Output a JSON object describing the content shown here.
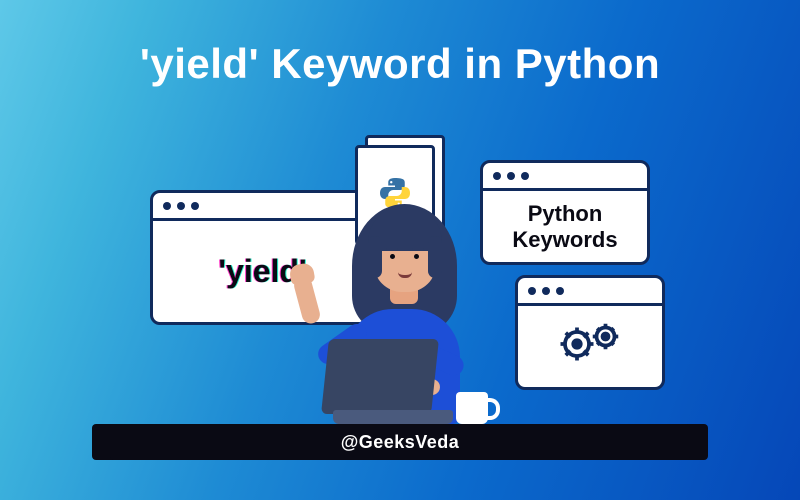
{
  "title_parts": {
    "keyword": "'yield'",
    "rest": " Keyword  in Python"
  },
  "card_left_text": "'yield'",
  "card_right_text": "Python\nKeywords",
  "desk_handle": "@GeeksVeda",
  "icons": {
    "python": "python-logo-icon",
    "gears": "gears-icon"
  }
}
